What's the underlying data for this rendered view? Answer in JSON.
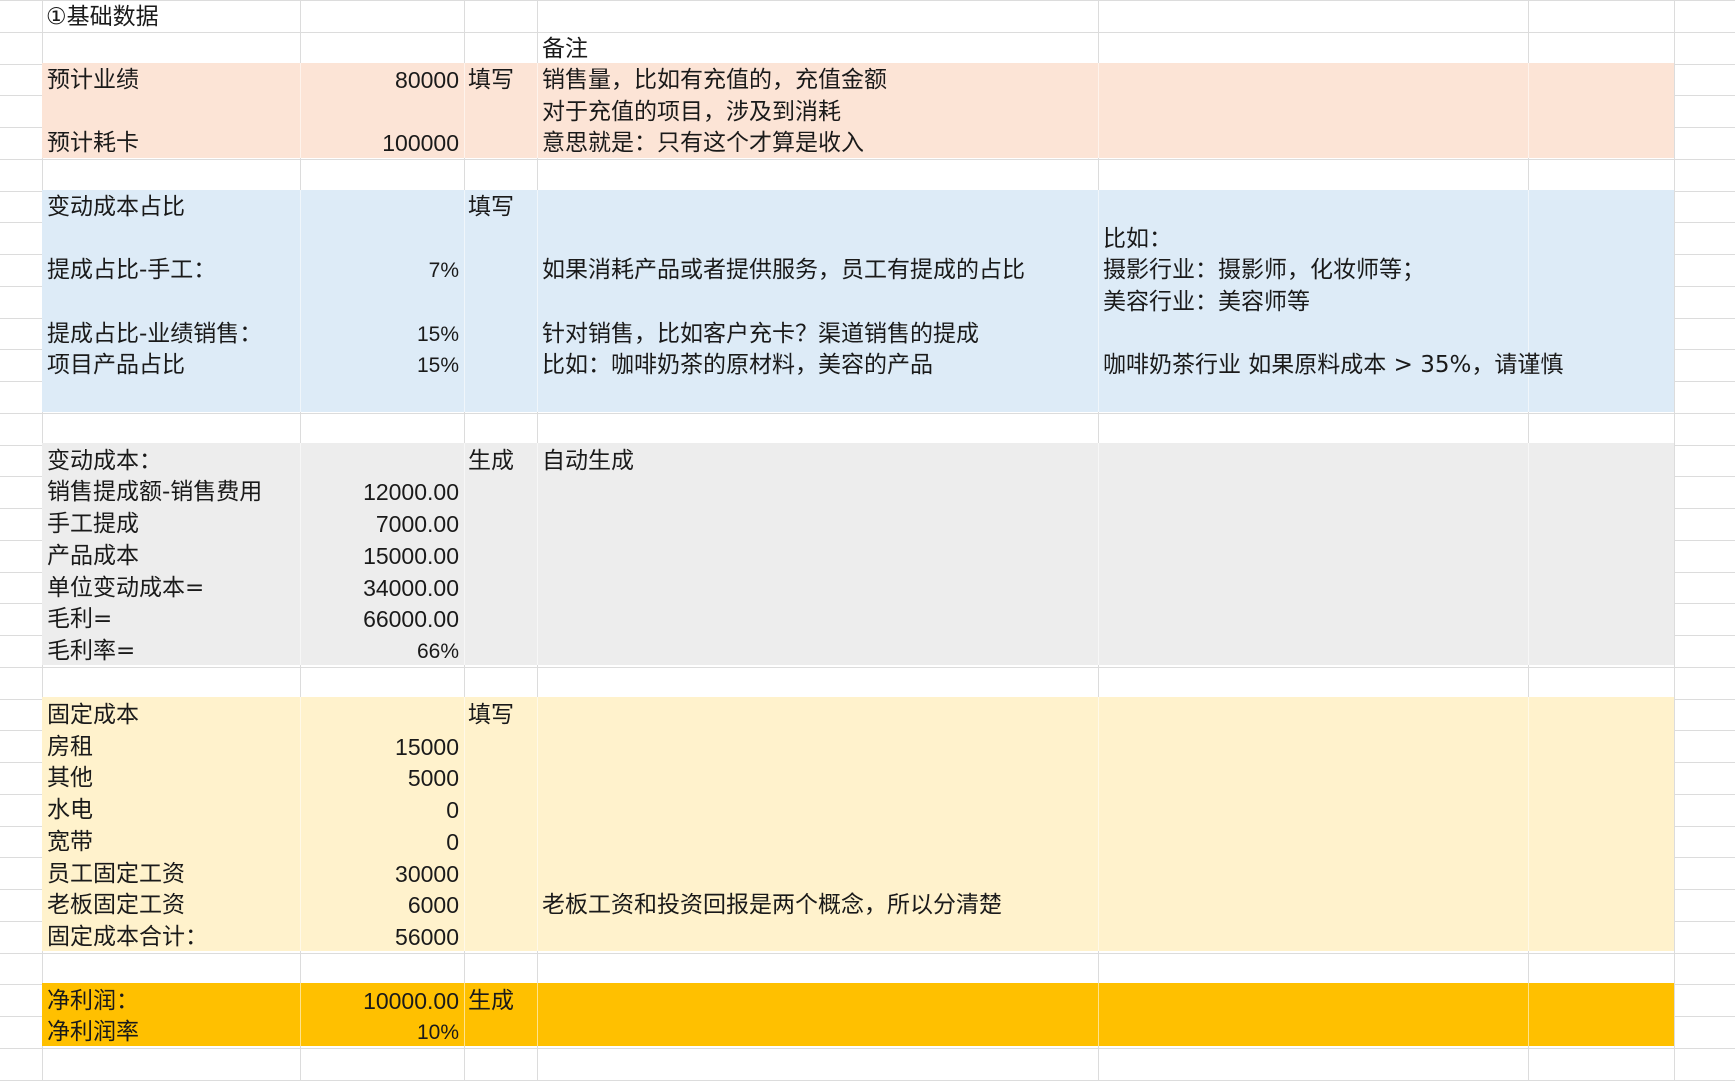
{
  "sheet": {
    "title": "①基础数据",
    "notes_header": "备注",
    "colors": {
      "salmon": "#fce4d6",
      "blue": "#ddebf7",
      "gray": "#ededed",
      "cream": "#fff2cc",
      "gold": "#ffc000",
      "gridline": "#dcdcdc"
    }
  },
  "basic": {
    "rows": [
      {
        "label": "预计业绩",
        "value": "80000",
        "tag": "填写",
        "note": "销售量，比如有充值的，充值金额"
      },
      {
        "label": "",
        "value": "",
        "tag": "",
        "note": "对于充值的项目，涉及到消耗"
      },
      {
        "label": "预计耗卡",
        "value": "100000",
        "tag": "",
        "note": "意思就是：只有这个才算是收入"
      }
    ]
  },
  "var_ratio": {
    "header": "变动成本占比",
    "tag": "填写",
    "example_label": "比如：",
    "rows": [
      {
        "label": "提成占比-手工：",
        "value": "7%",
        "note": "如果消耗产品或者提供服务，员工有提成的占比",
        "extra": "摄影行业：摄影师，化妆师等；"
      },
      {
        "label": "",
        "value": "",
        "note": "",
        "extra": "美容行业：美容师等"
      },
      {
        "label": "提成占比-业绩销售：",
        "value": "15%",
        "note": "针对销售，比如客户充卡？渠道销售的提成",
        "extra": ""
      },
      {
        "label": "项目产品占比",
        "value": "15%",
        "note": "比如：咖啡奶茶的原材料，美容的产品",
        "extra": "咖啡奶茶行业 如果原料成本 > 35%，请谨慎"
      }
    ]
  },
  "var_cost": {
    "header": "变动成本：",
    "tag": "生成",
    "note": "自动生成",
    "rows": [
      {
        "label": "销售提成额-销售费用",
        "value": "12000.00"
      },
      {
        "label": "手工提成",
        "value": "7000.00"
      },
      {
        "label": "产品成本",
        "value": "15000.00"
      },
      {
        "label": "单位变动成本=",
        "value": "34000.00"
      },
      {
        "label": "毛利=",
        "value": "66000.00"
      },
      {
        "label": "毛利率=",
        "value": "66%"
      }
    ]
  },
  "fixed_cost": {
    "header": "固定成本",
    "tag": "填写",
    "rows": [
      {
        "label": "房租",
        "value": "15000",
        "note": ""
      },
      {
        "label": "其他",
        "value": "5000",
        "note": ""
      },
      {
        "label": "水电",
        "value": "0",
        "note": ""
      },
      {
        "label": "宽带",
        "value": "0",
        "note": ""
      },
      {
        "label": "员工固定工资",
        "value": "30000",
        "note": ""
      },
      {
        "label": "老板固定工资",
        "value": "6000",
        "note": "老板工资和投资回报是两个概念，所以分清楚"
      },
      {
        "label": "固定成本合计：",
        "value": "56000",
        "note": ""
      }
    ]
  },
  "profit": {
    "tag": "生成",
    "rows": [
      {
        "label": "净利润：",
        "value": "10000.00"
      },
      {
        "label": "净利润率",
        "value": "10%"
      }
    ]
  }
}
